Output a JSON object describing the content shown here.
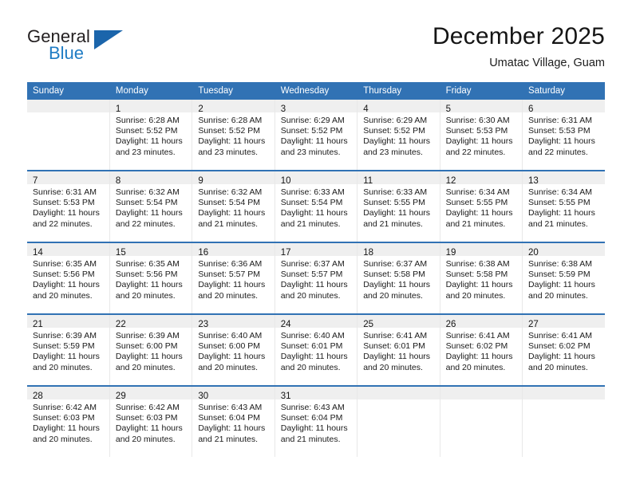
{
  "logo": {
    "word1": "General",
    "word2": "Blue",
    "triangle_color": "#1b65ab",
    "blue_text_color": "#1f7cc4"
  },
  "header": {
    "month_title": "December 2025",
    "location": "Umatac Village, Guam"
  },
  "theme": {
    "header_blue": "#3172b4",
    "daynum_band": "#efefef",
    "cell_divider": "#e8e8e8"
  },
  "weekday_headers": [
    "Sunday",
    "Monday",
    "Tuesday",
    "Wednesday",
    "Thursday",
    "Friday",
    "Saturday"
  ],
  "weeks": [
    [
      {
        "day": "",
        "lines": []
      },
      {
        "day": "1",
        "lines": [
          "Sunrise: 6:28 AM",
          "Sunset: 5:52 PM",
          "Daylight: 11 hours",
          "and 23 minutes."
        ]
      },
      {
        "day": "2",
        "lines": [
          "Sunrise: 6:28 AM",
          "Sunset: 5:52 PM",
          "Daylight: 11 hours",
          "and 23 minutes."
        ]
      },
      {
        "day": "3",
        "lines": [
          "Sunrise: 6:29 AM",
          "Sunset: 5:52 PM",
          "Daylight: 11 hours",
          "and 23 minutes."
        ]
      },
      {
        "day": "4",
        "lines": [
          "Sunrise: 6:29 AM",
          "Sunset: 5:52 PM",
          "Daylight: 11 hours",
          "and 23 minutes."
        ]
      },
      {
        "day": "5",
        "lines": [
          "Sunrise: 6:30 AM",
          "Sunset: 5:53 PM",
          "Daylight: 11 hours",
          "and 22 minutes."
        ]
      },
      {
        "day": "6",
        "lines": [
          "Sunrise: 6:31 AM",
          "Sunset: 5:53 PM",
          "Daylight: 11 hours",
          "and 22 minutes."
        ]
      }
    ],
    [
      {
        "day": "7",
        "lines": [
          "Sunrise: 6:31 AM",
          "Sunset: 5:53 PM",
          "Daylight: 11 hours",
          "and 22 minutes."
        ]
      },
      {
        "day": "8",
        "lines": [
          "Sunrise: 6:32 AM",
          "Sunset: 5:54 PM",
          "Daylight: 11 hours",
          "and 22 minutes."
        ]
      },
      {
        "day": "9",
        "lines": [
          "Sunrise: 6:32 AM",
          "Sunset: 5:54 PM",
          "Daylight: 11 hours",
          "and 21 minutes."
        ]
      },
      {
        "day": "10",
        "lines": [
          "Sunrise: 6:33 AM",
          "Sunset: 5:54 PM",
          "Daylight: 11 hours",
          "and 21 minutes."
        ]
      },
      {
        "day": "11",
        "lines": [
          "Sunrise: 6:33 AM",
          "Sunset: 5:55 PM",
          "Daylight: 11 hours",
          "and 21 minutes."
        ]
      },
      {
        "day": "12",
        "lines": [
          "Sunrise: 6:34 AM",
          "Sunset: 5:55 PM",
          "Daylight: 11 hours",
          "and 21 minutes."
        ]
      },
      {
        "day": "13",
        "lines": [
          "Sunrise: 6:34 AM",
          "Sunset: 5:55 PM",
          "Daylight: 11 hours",
          "and 21 minutes."
        ]
      }
    ],
    [
      {
        "day": "14",
        "lines": [
          "Sunrise: 6:35 AM",
          "Sunset: 5:56 PM",
          "Daylight: 11 hours",
          "and 20 minutes."
        ]
      },
      {
        "day": "15",
        "lines": [
          "Sunrise: 6:35 AM",
          "Sunset: 5:56 PM",
          "Daylight: 11 hours",
          "and 20 minutes."
        ]
      },
      {
        "day": "16",
        "lines": [
          "Sunrise: 6:36 AM",
          "Sunset: 5:57 PM",
          "Daylight: 11 hours",
          "and 20 minutes."
        ]
      },
      {
        "day": "17",
        "lines": [
          "Sunrise: 6:37 AM",
          "Sunset: 5:57 PM",
          "Daylight: 11 hours",
          "and 20 minutes."
        ]
      },
      {
        "day": "18",
        "lines": [
          "Sunrise: 6:37 AM",
          "Sunset: 5:58 PM",
          "Daylight: 11 hours",
          "and 20 minutes."
        ]
      },
      {
        "day": "19",
        "lines": [
          "Sunrise: 6:38 AM",
          "Sunset: 5:58 PM",
          "Daylight: 11 hours",
          "and 20 minutes."
        ]
      },
      {
        "day": "20",
        "lines": [
          "Sunrise: 6:38 AM",
          "Sunset: 5:59 PM",
          "Daylight: 11 hours",
          "and 20 minutes."
        ]
      }
    ],
    [
      {
        "day": "21",
        "lines": [
          "Sunrise: 6:39 AM",
          "Sunset: 5:59 PM",
          "Daylight: 11 hours",
          "and 20 minutes."
        ]
      },
      {
        "day": "22",
        "lines": [
          "Sunrise: 6:39 AM",
          "Sunset: 6:00 PM",
          "Daylight: 11 hours",
          "and 20 minutes."
        ]
      },
      {
        "day": "23",
        "lines": [
          "Sunrise: 6:40 AM",
          "Sunset: 6:00 PM",
          "Daylight: 11 hours",
          "and 20 minutes."
        ]
      },
      {
        "day": "24",
        "lines": [
          "Sunrise: 6:40 AM",
          "Sunset: 6:01 PM",
          "Daylight: 11 hours",
          "and 20 minutes."
        ]
      },
      {
        "day": "25",
        "lines": [
          "Sunrise: 6:41 AM",
          "Sunset: 6:01 PM",
          "Daylight: 11 hours",
          "and 20 minutes."
        ]
      },
      {
        "day": "26",
        "lines": [
          "Sunrise: 6:41 AM",
          "Sunset: 6:02 PM",
          "Daylight: 11 hours",
          "and 20 minutes."
        ]
      },
      {
        "day": "27",
        "lines": [
          "Sunrise: 6:41 AM",
          "Sunset: 6:02 PM",
          "Daylight: 11 hours",
          "and 20 minutes."
        ]
      }
    ],
    [
      {
        "day": "28",
        "lines": [
          "Sunrise: 6:42 AM",
          "Sunset: 6:03 PM",
          "Daylight: 11 hours",
          "and 20 minutes."
        ]
      },
      {
        "day": "29",
        "lines": [
          "Sunrise: 6:42 AM",
          "Sunset: 6:03 PM",
          "Daylight: 11 hours",
          "and 20 minutes."
        ]
      },
      {
        "day": "30",
        "lines": [
          "Sunrise: 6:43 AM",
          "Sunset: 6:04 PM",
          "Daylight: 11 hours",
          "and 21 minutes."
        ]
      },
      {
        "day": "31",
        "lines": [
          "Sunrise: 6:43 AM",
          "Sunset: 6:04 PM",
          "Daylight: 11 hours",
          "and 21 minutes."
        ]
      },
      {
        "day": "",
        "lines": []
      },
      {
        "day": "",
        "lines": []
      },
      {
        "day": "",
        "lines": []
      }
    ]
  ]
}
